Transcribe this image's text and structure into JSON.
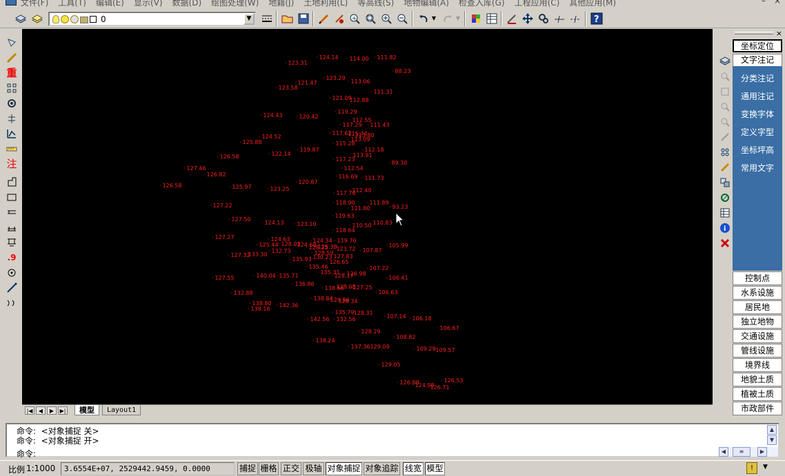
{
  "menubar": {
    "items": [
      "文件(F)",
      "工具(T)",
      "编辑(E)",
      "显示(V)",
      "数据(D)",
      "绘图处理(W)",
      "地籍(J)",
      "土地利用(L)",
      "等高线(S)",
      "地物编辑(A)",
      "检查入库(G)",
      "工程应用(C)",
      "其他应用(M)"
    ]
  },
  "toolbar": {
    "layer_value": "0"
  },
  "left_toolbar": {
    "icons": [
      "pencil-point-icon",
      "pencil-line-icon",
      "重",
      "node-grid-icon",
      "rotate-icon",
      "plant-icon",
      "elevation-icon",
      "ruler-icon",
      "注",
      "square-corner-icon",
      "rectangle-icon",
      "parallel-lines-icon",
      "double-lines-icon",
      "sign-icon",
      ".9",
      "circle-dot-icon",
      "slope-line-icon",
      "curve-icon"
    ]
  },
  "canvas": {
    "points": [
      {
        "t": "124.14"
      },
      {
        "t": "114.00"
      },
      {
        "t": "111.82"
      },
      {
        "t": "123.31"
      },
      {
        "t": "88.23"
      },
      {
        "t": "121.47"
      },
      {
        "t": "123.29"
      },
      {
        "t": "113.06"
      },
      {
        "t": "123.58"
      },
      {
        "t": "111.31"
      },
      {
        "t": "121.09"
      },
      {
        "t": "112.88"
      },
      {
        "t": "119.29"
      },
      {
        "t": "124.43"
      },
      {
        "t": "120.42"
      },
      {
        "t": "112.55"
      },
      {
        "t": "117.29"
      },
      {
        "t": "111.43"
      },
      {
        "t": "117.62"
      },
      {
        "t": "115.74"
      },
      {
        "t": "113.80"
      },
      {
        "t": "124.52"
      },
      {
        "t": "113.09"
      },
      {
        "t": "125.88"
      },
      {
        "t": "115.28"
      },
      {
        "t": "119.87"
      },
      {
        "t": "112.18"
      },
      {
        "t": "122.14"
      },
      {
        "t": "113.91"
      },
      {
        "t": "126.58"
      },
      {
        "t": "117.23"
      },
      {
        "t": "89.30"
      },
      {
        "t": "127.46"
      },
      {
        "t": "112.54"
      },
      {
        "t": "126.82"
      },
      {
        "t": "116.69"
      },
      {
        "t": "111.73"
      },
      {
        "t": "120.87"
      },
      {
        "t": "126.58"
      },
      {
        "t": "125.97"
      },
      {
        "t": "123.25"
      },
      {
        "t": "112.40"
      },
      {
        "t": "117.76"
      },
      {
        "t": "118.90"
      },
      {
        "t": "111.89"
      },
      {
        "t": "127.22"
      },
      {
        "t": "111.80"
      },
      {
        "t": "93.23"
      },
      {
        "t": "119.63"
      },
      {
        "t": "127.50"
      },
      {
        "t": "124.13"
      },
      {
        "t": "123.10"
      },
      {
        "t": "110.83"
      },
      {
        "t": "110.50"
      },
      {
        "t": "118.64"
      },
      {
        "t": "127.27"
      },
      {
        "t": "124.63"
      },
      {
        "t": "124.34"
      },
      {
        "t": "119.70"
      },
      {
        "t": "125.44"
      },
      {
        "t": "128.03"
      },
      {
        "t": "124.68"
      },
      {
        "t": "105.99"
      },
      {
        "t": "128.35"
      },
      {
        "t": "125.38"
      },
      {
        "t": "123.72"
      },
      {
        "t": "107.87"
      },
      {
        "t": "132.73"
      },
      {
        "t": "128.59"
      },
      {
        "t": "127.32"
      },
      {
        "t": "133.30"
      },
      {
        "t": "127.83"
      },
      {
        "t": "135.93"
      },
      {
        "t": "130.23"
      },
      {
        "t": "126.65"
      },
      {
        "t": "135.46"
      },
      {
        "t": "107.22"
      },
      {
        "t": "140.04"
      },
      {
        "t": "135.71"
      },
      {
        "t": "135.31"
      },
      {
        "t": "127.55"
      },
      {
        "t": "128.17"
      },
      {
        "t": "126.98"
      },
      {
        "t": "106.41"
      },
      {
        "t": "136.86"
      },
      {
        "t": "138.66"
      },
      {
        "t": "128.08"
      },
      {
        "t": "127.25"
      },
      {
        "t": "132.88"
      },
      {
        "t": "106.63"
      },
      {
        "t": "138.84"
      },
      {
        "t": "129.86"
      },
      {
        "t": "128.34"
      },
      {
        "t": "138.80"
      },
      {
        "t": "142.36"
      },
      {
        "t": "138.16"
      },
      {
        "t": "135.79"
      },
      {
        "t": "128.31"
      },
      {
        "t": "107.14"
      },
      {
        "t": "106.18"
      },
      {
        "t": "142.56"
      },
      {
        "t": "132.56"
      },
      {
        "t": "106.67"
      },
      {
        "t": "128.29"
      },
      {
        "t": "108.82"
      },
      {
        "t": "138.24"
      },
      {
        "t": "137.36"
      },
      {
        "t": "129.09"
      },
      {
        "t": "109.29"
      },
      {
        "t": "109.57"
      },
      {
        "t": "129.05"
      },
      {
        "t": "126.53"
      },
      {
        "t": "126.88"
      },
      {
        "t": "124.98"
      },
      {
        "t": "126.71"
      }
    ]
  },
  "tabs": {
    "model": "模型",
    "layout1": "Layout1"
  },
  "right_panel": {
    "top_buttons": [
      "坐标定位",
      "文字注记"
    ],
    "blue_items": [
      "分类注记",
      "通用注记",
      "变换字体",
      "定义字型",
      "坐标坪高",
      "常用文字"
    ],
    "categories": [
      "控制点",
      "水系设施",
      "居民地",
      "独立地物",
      "交通设施",
      "管线设施",
      "境界线",
      "地貌土质",
      "植被土质",
      "市政部件"
    ]
  },
  "command": {
    "line1": "命令:  <对象捕捉 关>",
    "line2": "命令:  <对象捕捉 开>",
    "prompt": "命令:"
  },
  "status": {
    "label": "比例",
    "scale": "1:1000",
    "coords": "3.6554E+07, 2529442.9459, 0.0000",
    "toggles": [
      {
        "label": "捕捉",
        "on": false
      },
      {
        "label": "栅格",
        "on": false
      },
      {
        "label": "正交",
        "on": false
      },
      {
        "label": "极轴",
        "on": false
      },
      {
        "label": "对象捕捉",
        "on": true
      },
      {
        "label": "对象追踪",
        "on": false
      },
      {
        "label": "线宽",
        "on": true
      },
      {
        "label": "模型",
        "on": true
      }
    ]
  },
  "colors": {
    "canvas_bg": "#000000",
    "point_text": "#ff2020",
    "panel_blue": "#3a6ea5",
    "chrome": "#d4d0c8"
  }
}
